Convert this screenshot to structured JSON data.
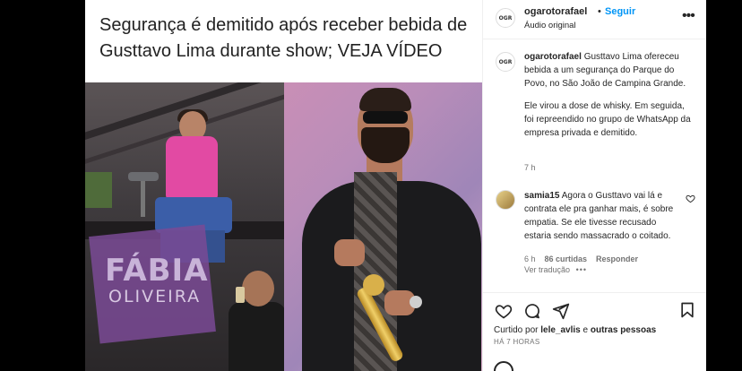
{
  "post": {
    "headline": "Segurança é demitido após receber bebida de Gusttavo Lima durante show; VEJA VÍDEO",
    "watermark_line1": "FÁBIA",
    "watermark_line2": "OLIVEIRA"
  },
  "header": {
    "avatar_text": "OGR",
    "username": "ogarotorafael",
    "separator": "•",
    "follow_label": "Seguir",
    "audio_label": "Áudio original",
    "more_icon": "•••"
  },
  "caption": {
    "avatar_text": "OGR",
    "username": "ogarotorafael",
    "paragraph1": "Gusttavo Lima ofereceu bebida a um segurança do Parque do Povo, no São João de Campina Grande.",
    "paragraph2": "Ele virou a dose de whisky. Em seguida, foi repreendido no grupo de WhatsApp da empresa privada e demitido.",
    "time": "7 h"
  },
  "comment": {
    "username": "samia15",
    "text": "Agora o Gusttavo vai lá e contrata ele pra ganhar mais, é sobre empatia. Se ele tivesse recusado estaria sendo massacrado o coitado.",
    "time": "6 h",
    "likes": "86 curtidas",
    "reply_label": "Responder",
    "see_translation": "Ver tradução",
    "more_dots": "•••"
  },
  "actions": {
    "liked_by_prefix": "Curtido por",
    "liked_by_user": "lele_avlis",
    "liked_by_suffix": "e",
    "liked_by_others": "outras pessoas",
    "posted_time": "HÁ 7 HORAS"
  },
  "colors": {
    "link": "#0095f6",
    "text": "#262626",
    "muted": "#737373",
    "backdrop": "#000000"
  },
  "icons": [
    "heart-icon",
    "comment-icon",
    "share-icon",
    "bookmark-icon",
    "more-options-icon"
  ]
}
